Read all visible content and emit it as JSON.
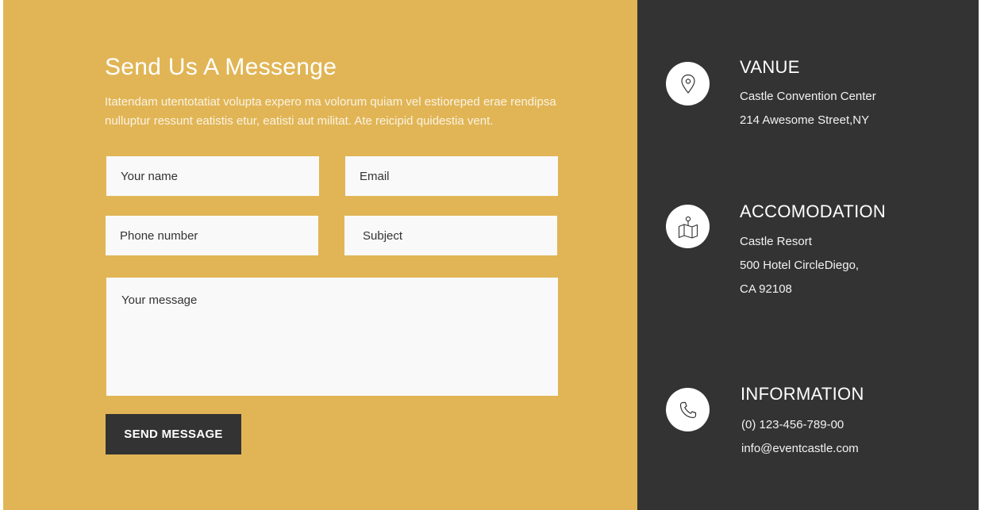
{
  "contact_form": {
    "title": "Send Us A Messenge",
    "description": "Itatendam utentotatiat volupta expero ma volorum quiam vel estioreped erae rendipsa nulluptur ressunt eatistis etur, eatisti aut militat. Ate reicipid quidestia vent.",
    "name_placeholder": "Your name",
    "email_placeholder": "Email",
    "phone_placeholder": "Phone number",
    "subject_placeholder": "Subject",
    "message_placeholder": "Your message",
    "send_label": "SEND MESSAGE"
  },
  "venue": {
    "icon": "location-pin-icon",
    "title": "VANUE",
    "line1": "Castle Convention Center",
    "line2": "214 Awesome Street,NY"
  },
  "accommodation": {
    "icon": "map-icon",
    "title": "ACCOMODATION",
    "line1": "Castle Resort",
    "line2": "500 Hotel CircleDiego,",
    "line3": "CA 92108"
  },
  "information": {
    "icon": "phone-icon",
    "title": "INFORMATION",
    "phone": "(0) 123-456-789-00",
    "email": "info@eventcastle.com"
  },
  "colors": {
    "form_background": "#e1b556",
    "info_background": "#333333",
    "button_background": "#333333",
    "input_background": "#f9f9f9"
  }
}
